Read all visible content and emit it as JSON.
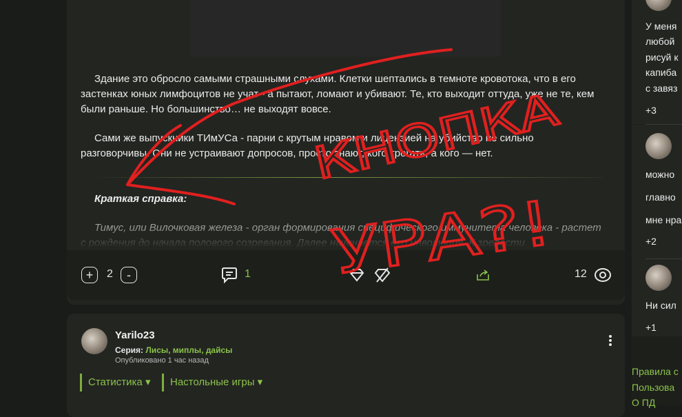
{
  "post": {
    "paragraphs": [
      "Здание это обросло самыми страшными слухами. Клетки шептались в темноте кровотока, что в его застенках юных лимфоцитов не учат - а пытают, ломают и убивают. Те, кто выходит оттуда, уже не те, кем были раньше. Но большинство… не выходят вовсе.",
      "Сами же выпускники ТИмУСа - парни с крутым нравом и лицензией на убийство не сильно разговорчивы. Они не устраивают допросов, просто знают, кого трогать, а кого — нет."
    ],
    "brief_title": "Краткая справка:",
    "brief_text": "Тимус, или Вилочковая железа - орган формирования специфического иммунитета человека - растет с рождения до начала полового созревания. Далее начинается его инволюция. К зрелости"
  },
  "actions": {
    "plus": "+",
    "rating": "2",
    "minus": "-",
    "comments": "1",
    "views": "12"
  },
  "annotation": {
    "text_1": "КНОПКА",
    "text_2": "УРА?!",
    "color": "#e0201f"
  },
  "card2": {
    "author": "Yarilo23",
    "series_label": "Серия:",
    "series_value": "Лисы, миплы, дайсы",
    "published": "Опубликовано 1 час назад",
    "tags": [
      "Статистика ▾",
      "Настольные игры ▾"
    ]
  },
  "comments": {
    "c1_lines": [
      "У меня",
      "любой",
      "рисуй к",
      "капиба",
      "с завяз"
    ],
    "c1_score": "+3",
    "c2_lines": [
      "можно",
      "главно",
      "мне нра"
    ],
    "c2_score": "+2",
    "c3_lines": [
      "Ни сил"
    ],
    "c3_score": "+1"
  },
  "footer_links": [
    "Правила с",
    "Пользова",
    "О ПД"
  ],
  "colors": {
    "background": "#1a1c19",
    "card": "#232521",
    "accent_green": "#8bc34a",
    "annotation_red": "#e0201f"
  }
}
